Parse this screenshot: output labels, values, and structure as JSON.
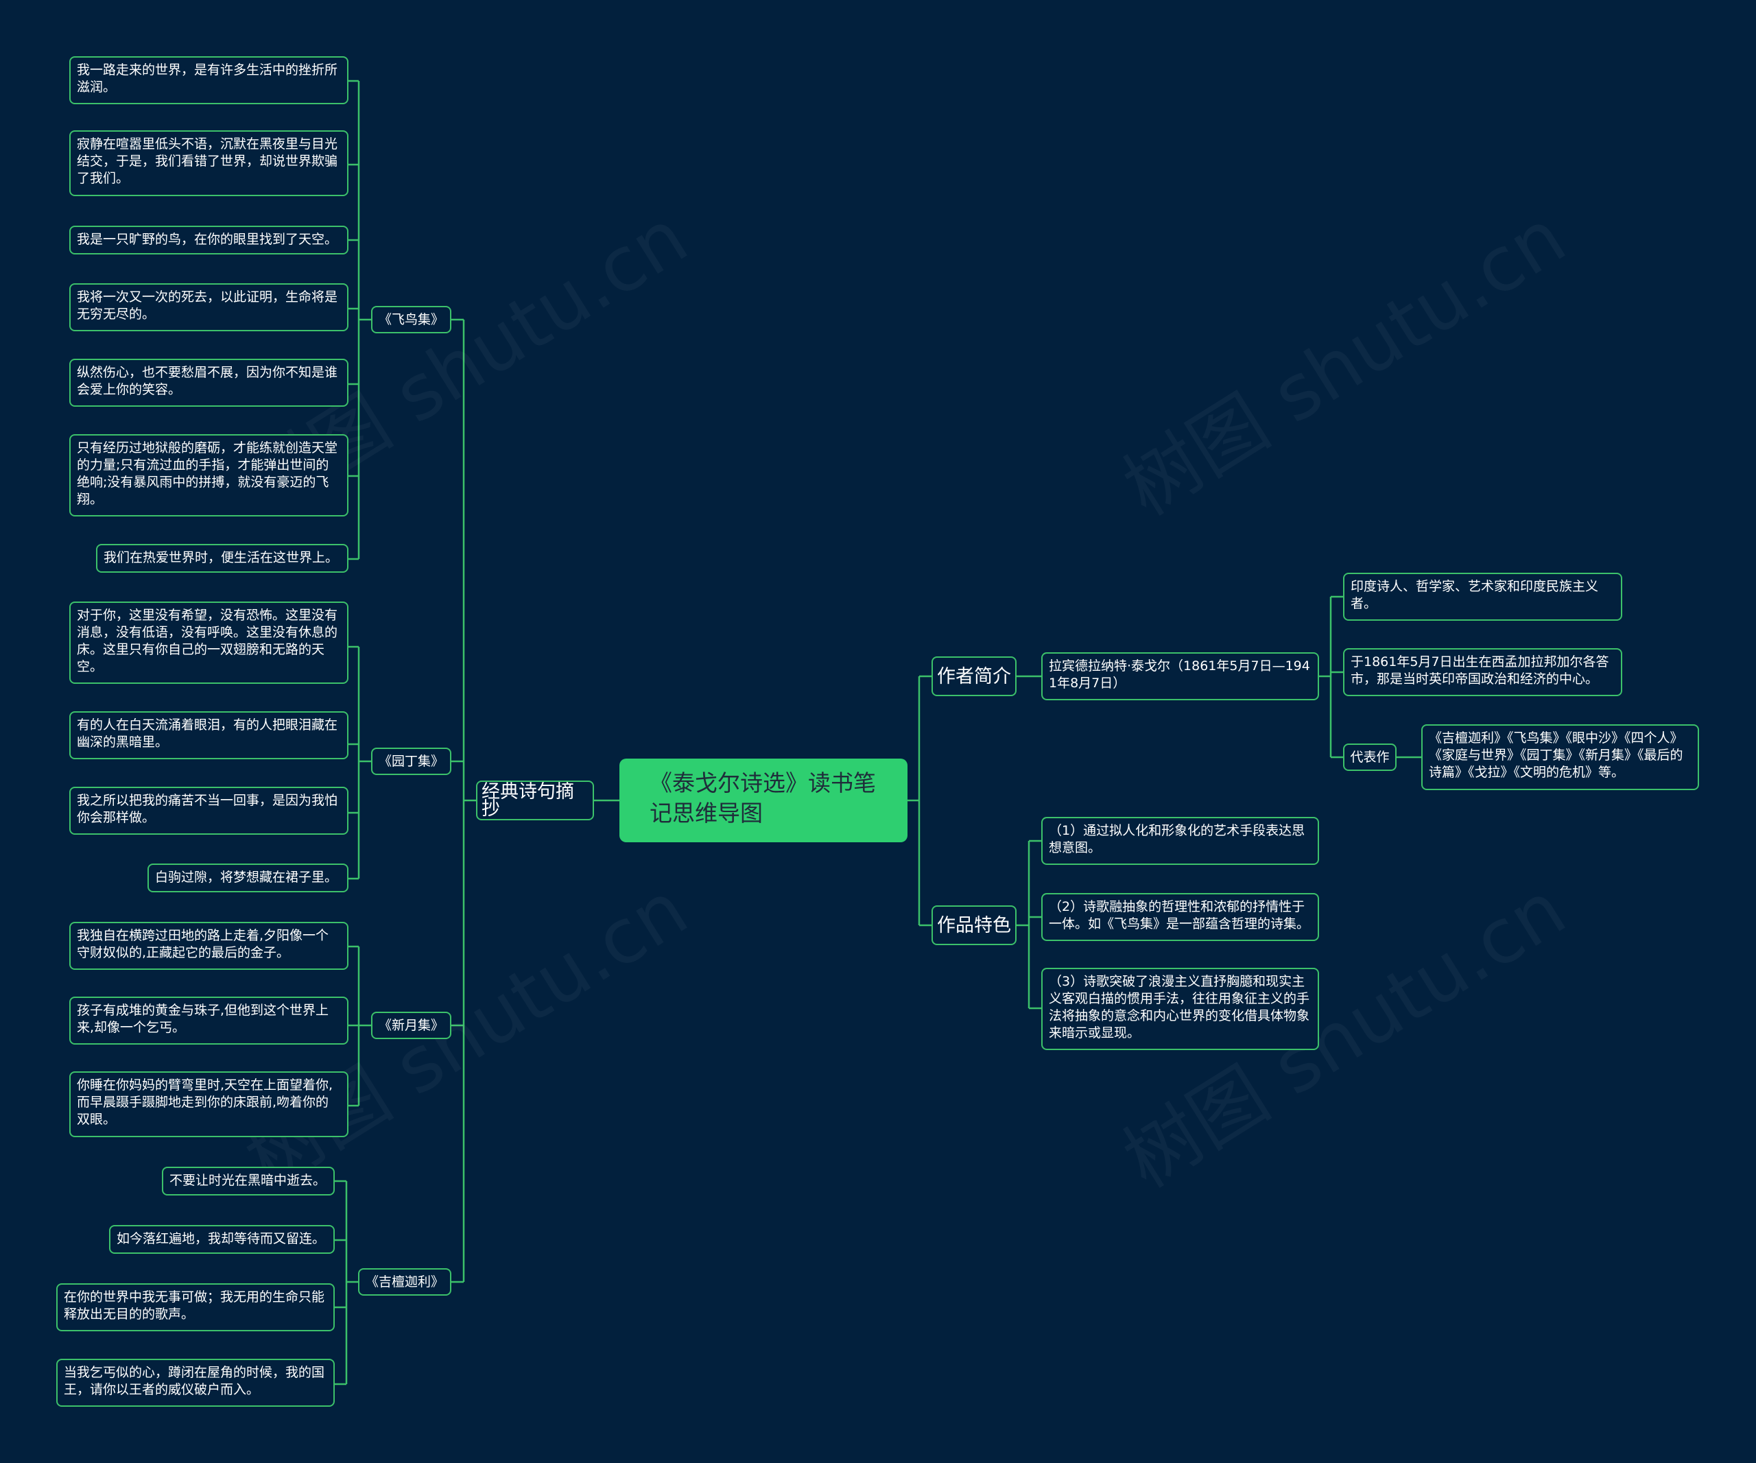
{
  "root": {
    "title": "《泰戈尔诗选》读书笔记思维导图"
  },
  "branches": {
    "quotes": {
      "label": "经典诗句摘抄",
      "feiniaoji": {
        "label": "《飞鸟集》",
        "items": [
          "我一路走来的世界，是有许多生活中的挫折所滋润。",
          "寂静在喧嚣里低头不语，沉默在黑夜里与目光结交，于是，我们看错了世界，却说世界欺骗了我们。",
          "我是一只旷野的鸟，在你的眼里找到了天空。",
          "我将一次又一次的死去，以此证明，生命将是无穷无尽的。",
          "纵然伤心，也不要愁眉不展，因为你不知是谁会爱上你的笑容。",
          "只有经历过地狱般的磨砺，才能练就创造天堂的力量;只有流过血的手指，才能弹出世间的绝响;没有暴风雨中的拼搏，就没有豪迈的飞翔。",
          "我们在热爱世界时，便生活在这世界上。"
        ]
      },
      "yuandingji": {
        "label": "《园丁集》",
        "items": [
          "对于你，这里没有希望，没有恐怖。这里没有消息，没有低语，没有呼唤。这里没有休息的床。这里只有你自己的一双翅膀和无路的天空。",
          "有的人在白天流涌着眼泪，有的人把眼泪藏在幽深的黑暗里。",
          "我之所以把我的痛苦不当一回事，是因为我怕你会那样做。",
          "白驹过隙，将梦想藏在裙子里。"
        ]
      },
      "xinyueji": {
        "label": "《新月集》",
        "items": [
          "我独自在横跨过田地的路上走着,夕阳像一个守财奴似的,正藏起它的最后的金子。",
          "孩子有成堆的黄金与珠子,但他到这个世界上来,却像一个乞丐。",
          "你睡在你妈妈的臂弯里时,天空在上面望着你,而早晨蹑手蹑脚地走到你的床跟前,吻着你的双眼。"
        ]
      },
      "jitanjiali": {
        "label": "《吉檀迦利》",
        "items": [
          "不要让时光在黑暗中逝去。",
          "如今落红遍地，我却等待而又留连。",
          "在你的世界中我无事可做；我无用的生命只能释放出无目的的歌声。",
          "当我乞丐似的心，蹲闭在屋角的时候，我的国王，请你以王者的威仪破户而入。"
        ]
      }
    },
    "author": {
      "label": "作者简介",
      "name": "拉宾德拉纳特·泰戈尔（1861年5月7日—1941年8月7日）",
      "facts": [
        "印度诗人、哲学家、艺术家和印度民族主义者。",
        "于1861年5月7日出生在西孟加拉邦加尔各答市，那是当时英印帝国政治和经济的中心。"
      ],
      "works_label": "代表作",
      "works": "《吉檀迦利》《飞鸟集》《眼中沙》《四个人》《家庭与世界》《园丁集》《新月集》《最后的诗篇》《戈拉》《文明的危机》等。"
    },
    "features": {
      "label": "作品特色",
      "items": [
        "（1）通过拟人化和形象化的艺术手段表达思想意图。",
        "（2）诗歌融抽象的哲理性和浓郁的抒情性于一体。如《飞鸟集》是一部蕴含哲理的诗集。",
        "（3）诗歌突破了浪漫主义直抒胸臆和现实主义客观白描的惯用手法，往往用象征主义的手法将抽象的意念和内心世界的变化借具体物象来暗示或显现。"
      ]
    }
  },
  "watermark": "树图 shutu.cn",
  "colors": {
    "background": "#02203d",
    "line": "#3cc16a",
    "root_fill": "#2ecf70"
  }
}
